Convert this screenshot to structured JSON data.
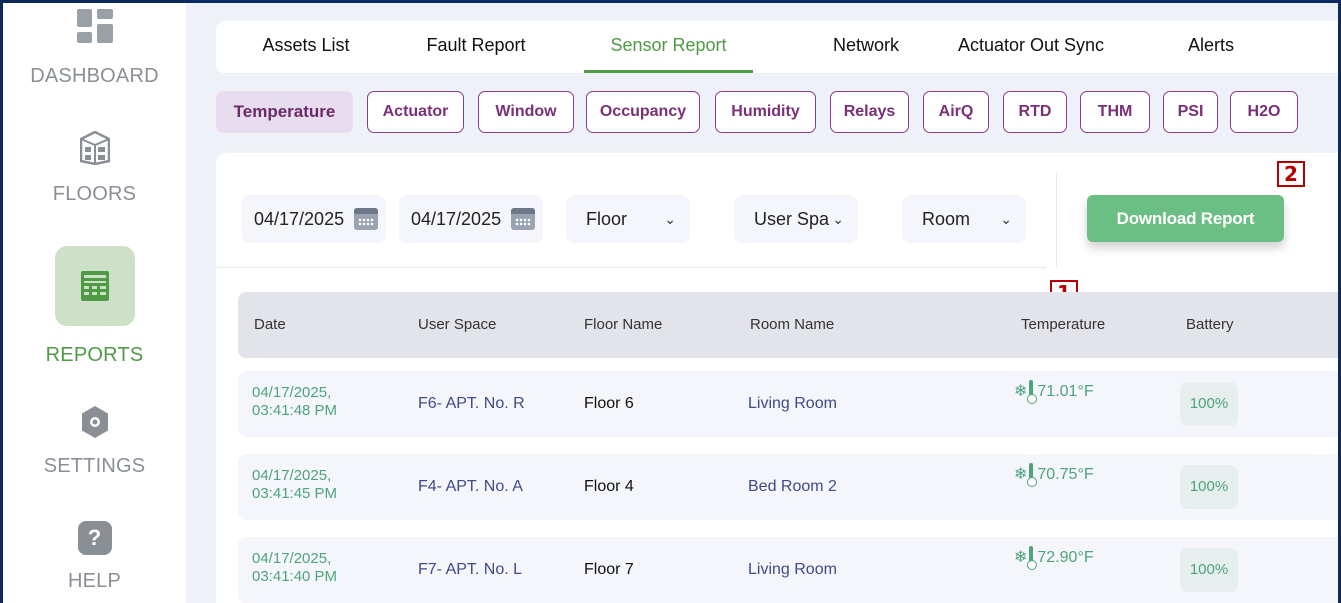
{
  "sidebar": {
    "items": [
      {
        "label": "DASHBOARD",
        "icon": "dashboard-grid-icon"
      },
      {
        "label": "FLOORS",
        "icon": "building-icon"
      },
      {
        "label": "REPORTS",
        "icon": "report-sheet-icon",
        "active": true
      },
      {
        "label": "SETTINGS",
        "icon": "gear-icon"
      },
      {
        "label": "HELP",
        "icon": "help-icon",
        "glyph": "?"
      }
    ]
  },
  "tabs": [
    {
      "label": "Assets List"
    },
    {
      "label": "Fault Report"
    },
    {
      "label": "Sensor Report",
      "active": true
    },
    {
      "label": "Network"
    },
    {
      "label": "Actuator Out Sync"
    },
    {
      "label": "Alerts"
    }
  ],
  "chips": [
    {
      "label": "Temperature",
      "active": true
    },
    {
      "label": "Actuator"
    },
    {
      "label": "Window"
    },
    {
      "label": "Occupancy"
    },
    {
      "label": "Humidity"
    },
    {
      "label": "Relays"
    },
    {
      "label": "AirQ"
    },
    {
      "label": "RTD"
    },
    {
      "label": "THM"
    },
    {
      "label": "PSI"
    },
    {
      "label": "H2O"
    }
  ],
  "filters": {
    "start_date": "04/17/2025",
    "end_date": "04/17/2025",
    "floor": "Floor",
    "user_space": "User Spa",
    "room": "Room",
    "chevron": "⌄"
  },
  "download_label": "Download Report",
  "badges": {
    "one": "1",
    "two": "2"
  },
  "table": {
    "headers": [
      "Date",
      "User Space",
      "Floor Name",
      "Room Name",
      "Temperature",
      "Battery"
    ],
    "rows": [
      {
        "date": "04/17/2025,",
        "time": "03:41:48 PM",
        "user_space": "F6- APT. No. R",
        "floor": "Floor 6",
        "room": "Living Room",
        "temperature": "71.01°F",
        "battery": "100%"
      },
      {
        "date": "04/17/2025,",
        "time": "03:41:45 PM",
        "user_space": "F4- APT. No. A",
        "floor": "Floor 4",
        "room": "Bed Room 2",
        "temperature": "70.75°F",
        "battery": "100%"
      },
      {
        "date": "04/17/2025,",
        "time": "03:41:40 PM",
        "user_space": "F7- APT. No. L",
        "floor": "Floor 7",
        "room": "Living Room",
        "temperature": "72.90°F",
        "battery": "100%"
      }
    ]
  },
  "colors": {
    "accent_green": "#4f9a45",
    "chip_purple": "#7a2f78",
    "button_green": "#6cbf84",
    "badge_red": "#b30000"
  }
}
